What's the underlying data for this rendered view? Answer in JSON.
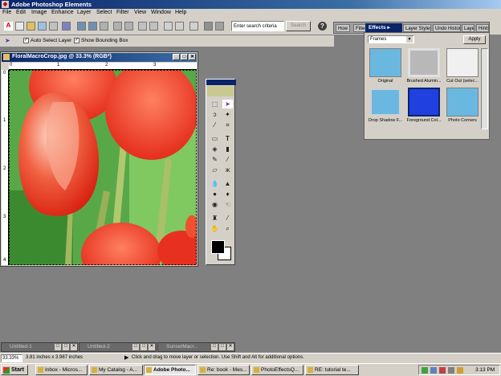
{
  "app": {
    "title": "Adobe Photoshop Elements"
  },
  "menu": [
    "File",
    "Edit",
    "Image",
    "Enhance",
    "Layer",
    "Select",
    "Filter",
    "View",
    "Window",
    "Help"
  ],
  "toolbar": {
    "search_placeholder": "Enter search criteria",
    "search_label": "Search"
  },
  "palette_well": {
    "tabs": [
      "How To",
      "Filters",
      "Effects",
      "Layer Styles",
      "Undo History",
      "Layers",
      "Hints"
    ]
  },
  "options": {
    "auto_select_label": "Auto Select Layer",
    "bounding_box_label": "Show Bounding Box"
  },
  "document": {
    "title": "FloralMacroCrop.jpg @ 33.3% (RGB*)",
    "ruler_top": [
      "0",
      "1",
      "2",
      "3"
    ],
    "ruler_left": [
      "0",
      "1",
      "2",
      "3",
      "4"
    ]
  },
  "effects": {
    "tab_label": "Effects",
    "category": "Frames",
    "apply_label": "Apply",
    "thumbnails": [
      {
        "label": "Original",
        "style": "plain"
      },
      {
        "label": "Brushed Alumin...",
        "style": "metal"
      },
      {
        "label": "Cut Out (selec...",
        "style": "cutout"
      },
      {
        "label": "Drop Shadow F...",
        "style": "shadow"
      },
      {
        "label": "Foreground Col...",
        "style": "blue"
      },
      {
        "label": "Photo Corners",
        "style": "corners"
      }
    ]
  },
  "minimized": [
    "Untitled-1",
    "Untitled-2",
    "SunsetMacr..."
  ],
  "status": {
    "zoom": "33.33%",
    "doc_size": "3.81 inches x 3.987 inches",
    "hint": "Click and drag to move layer or selection. Use Shift and Alt for additional options."
  },
  "taskbar": {
    "start_label": "Start",
    "tasks": [
      "Inbox - Micros...",
      "My Catalog - A...",
      "Adobe Photo...",
      "Re: book - Mes...",
      "PhotoEffectsQ...",
      "RE: tutorial te..."
    ],
    "clock": "3:13 PM"
  },
  "colors": {
    "title_blue": "#0a246a",
    "canvas_red": "#e8321e",
    "foreground": "#000000",
    "background": "#ffffff"
  }
}
